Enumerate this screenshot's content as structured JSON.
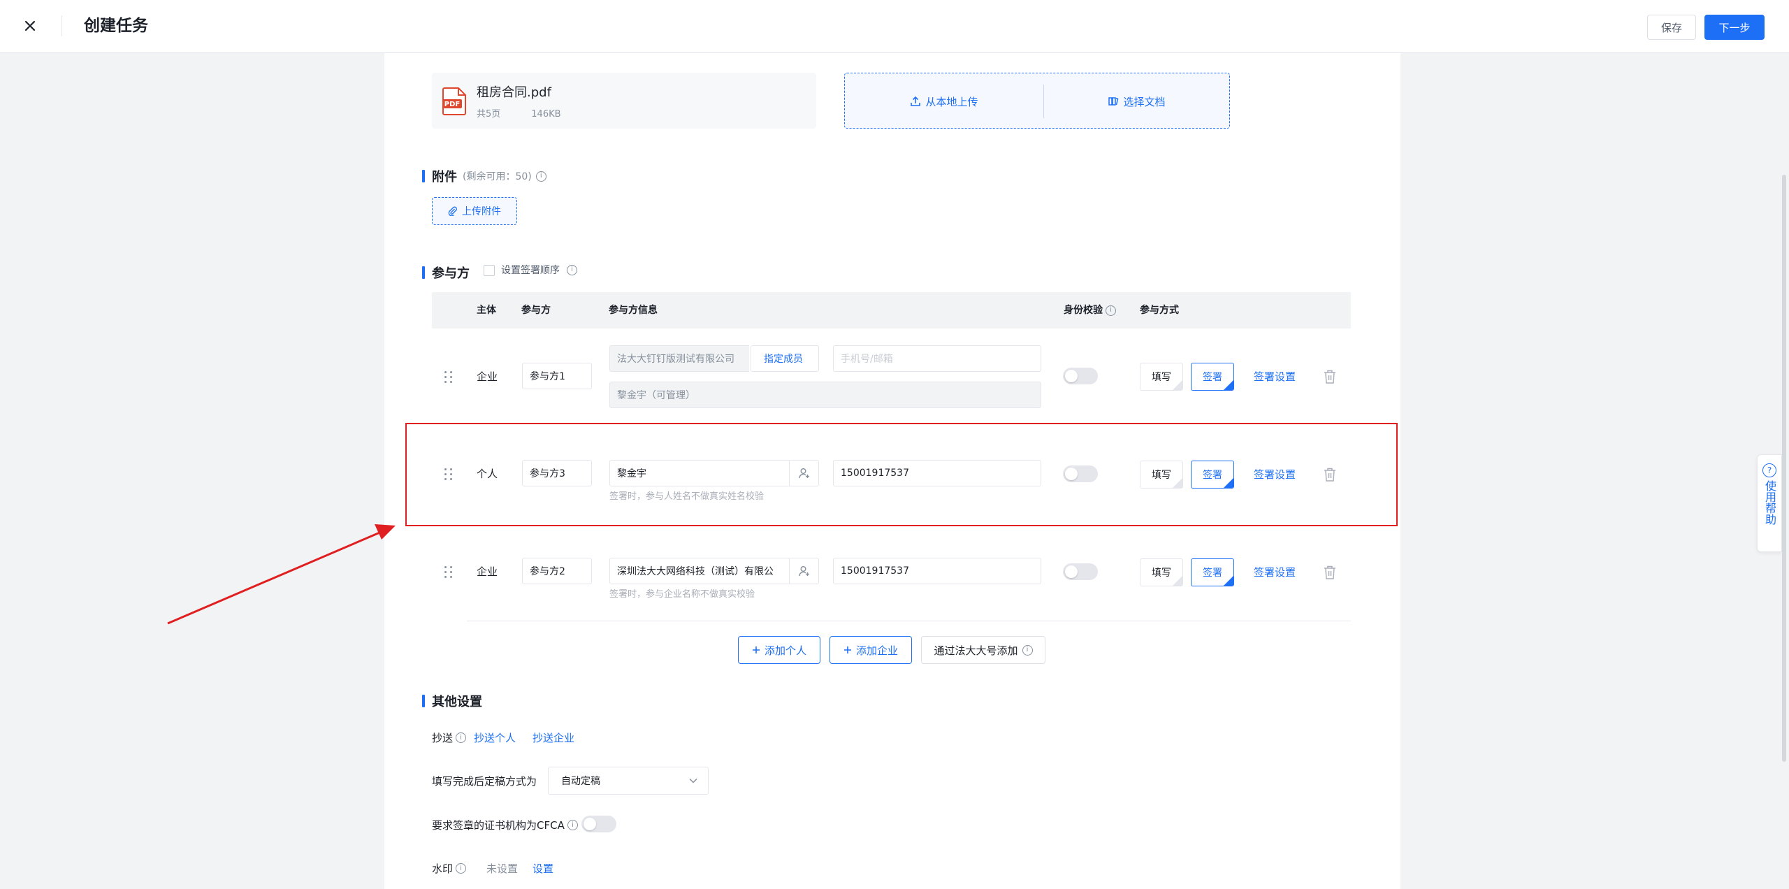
{
  "header": {
    "title": "创建任务",
    "save_label": "保存",
    "next_label": "下一步"
  },
  "document": {
    "file_name": "租房合同.pdf",
    "pages": "共5页",
    "size": "146KB",
    "upload_local": "从本地上传",
    "choose_doc": "选择文档",
    "pdf_badge": "PDF"
  },
  "attachment": {
    "title": "附件",
    "remaining": "(剩余可用：50)",
    "upload_label": "上传附件"
  },
  "participants": {
    "title": "参与方",
    "order_label": "设置签署顺序",
    "columns": {
      "subject": "主体",
      "party": "参与方",
      "info": "参与方信息",
      "verify": "身份校验",
      "mode": "参与方式"
    },
    "rows": [
      {
        "subject": "企业",
        "party": "参与方1",
        "company": "法大大钉钉版测试有限公司",
        "assign": "指定成员",
        "contact_placeholder": "手机号/邮箱",
        "member": "黎金宇（可管理）",
        "fill": "填写",
        "sign": "签署",
        "settings": "签署设置"
      },
      {
        "subject": "个人",
        "party": "参与方3",
        "name": "黎金宇",
        "contact": "15001917537",
        "hint": "签署时，参与人姓名不做真实姓名校验",
        "fill": "填写",
        "sign": "签署",
        "settings": "签署设置"
      },
      {
        "subject": "企业",
        "party": "参与方2",
        "company": "深圳法大大网络科技（测试）有限公",
        "contact": "15001917537",
        "hint": "签署时，参与企业名称不做真实校验",
        "fill": "填写",
        "sign": "签署",
        "settings": "签署设置"
      }
    ],
    "add_person": "添加个人",
    "add_company": "添加企业",
    "add_via": "通过法大大号添加"
  },
  "other": {
    "title": "其他设置",
    "cc_label": "抄送",
    "cc_person": "抄送个人",
    "cc_company": "抄送企业",
    "finalize_label": "填写完成后定稿方式为",
    "finalize_value": "自动定稿",
    "cfca_label": "要求签章的证书机构为CFCA",
    "watermark_label": "水印",
    "watermark_status": "未设置",
    "watermark_set": "设置"
  },
  "help": {
    "label": "使用帮助"
  },
  "colors": {
    "primary": "#1d6ff5",
    "annotation": "#e02020"
  }
}
